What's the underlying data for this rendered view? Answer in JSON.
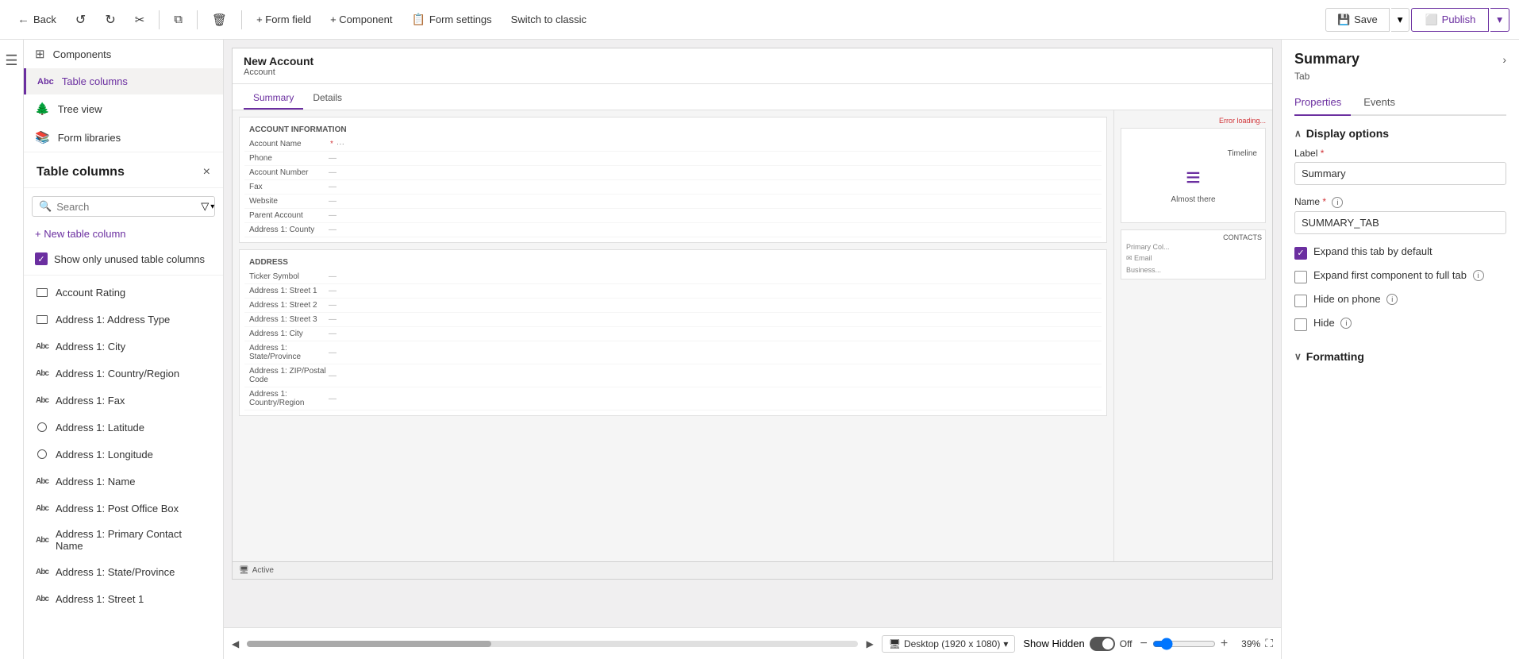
{
  "toolbar": {
    "back_label": "Back",
    "form_field_label": "+ Form field",
    "component_label": "+ Component",
    "form_settings_label": "Form settings",
    "switch_classic_label": "Switch to classic",
    "save_label": "Save",
    "publish_label": "Publish"
  },
  "left_panel": {
    "title": "Table columns",
    "close_label": "×",
    "search_placeholder": "Search",
    "new_column_label": "+ New table column",
    "show_unused_label": "Show only unused table columns",
    "nav_items": [
      {
        "id": "components",
        "label": "Components",
        "icon": "⊞"
      },
      {
        "id": "table-columns",
        "label": "Table columns",
        "icon": "Abc",
        "active": true
      },
      {
        "id": "tree-view",
        "label": "Tree view",
        "icon": "≡"
      },
      {
        "id": "form-libraries",
        "label": "Form libraries",
        "icon": "📚"
      }
    ],
    "columns": [
      {
        "id": "account-rating",
        "label": "Account Rating",
        "icon": "rect"
      },
      {
        "id": "address1-type",
        "label": "Address 1: Address Type",
        "icon": "rect"
      },
      {
        "id": "address1-city",
        "label": "Address 1: City",
        "icon": "abc"
      },
      {
        "id": "address1-country",
        "label": "Address 1: Country/Region",
        "icon": "abc"
      },
      {
        "id": "address1-fax",
        "label": "Address 1: Fax",
        "icon": "abc",
        "has_more": true
      },
      {
        "id": "address1-latitude",
        "label": "Address 1: Latitude",
        "icon": "circle"
      },
      {
        "id": "address1-longitude",
        "label": "Address 1: Longitude",
        "icon": "circle"
      },
      {
        "id": "address1-name",
        "label": "Address 1: Name",
        "icon": "abc"
      },
      {
        "id": "address1-po-box",
        "label": "Address 1: Post Office Box",
        "icon": "abc"
      },
      {
        "id": "address1-primary-contact",
        "label": "Address 1: Primary Contact Name",
        "icon": "abc"
      },
      {
        "id": "address1-state",
        "label": "Address 1: State/Province",
        "icon": "abc"
      },
      {
        "id": "address1-street1",
        "label": "Address 1: Street 1",
        "icon": "abc"
      }
    ]
  },
  "form_canvas": {
    "form_title": "New Account",
    "form_subtitle": "Account",
    "tabs": [
      {
        "label": "Summary",
        "active": true
      },
      {
        "label": "Details",
        "active": false
      }
    ],
    "account_info_section": "ACCOUNT INFORMATION",
    "fields": [
      {
        "label": "Account Name",
        "required": true,
        "value": "—"
      },
      {
        "label": "Phone",
        "value": "—"
      },
      {
        "label": "Account Number",
        "value": "—"
      },
      {
        "label": "Fax",
        "value": "—"
      },
      {
        "label": "Website",
        "value": "—"
      },
      {
        "label": "Parent Account",
        "value": "—"
      },
      {
        "label": "Address 1: County",
        "value": "—"
      }
    ],
    "timeline_label": "Timeline",
    "timeline_icon_text": "≡",
    "timeline_almost_there": "Almost there",
    "error_link": "Error loading...",
    "address_section": "ADDRESS",
    "address_fields": [
      {
        "label": "Ticker Symbol",
        "value": "—"
      },
      {
        "label": "Address 1: Street 1",
        "value": "—"
      },
      {
        "label": "Address 1: Street 2",
        "value": "—"
      },
      {
        "label": "Address 1: Street 3",
        "value": "—"
      },
      {
        "label": "Address 1: City",
        "value": "—"
      },
      {
        "label": "Address 1: State/Province",
        "value": "—"
      },
      {
        "label": "Address 1: ZIP/Postal Code",
        "value": "—"
      },
      {
        "label": "Address 1: Country/Region",
        "value": "—"
      }
    ],
    "status_label": "Active",
    "viewport_label": "Desktop (1920 x 1080)",
    "show_hidden_label": "Show Hidden",
    "toggle_state": "Off",
    "zoom_level": "39%"
  },
  "right_panel": {
    "title": "Summary",
    "subtitle": "Tab",
    "tabs": [
      {
        "label": "Properties",
        "active": true
      },
      {
        "label": "Events",
        "active": false
      }
    ],
    "display_options": {
      "section_label": "Display options",
      "label_field_label": "Label",
      "label_required": true,
      "label_value": "Summary",
      "name_field_label": "Name",
      "name_required": true,
      "name_value": "SUMMARY_TAB",
      "expand_tab_label": "Expand this tab by default",
      "expand_tab_checked": true,
      "expand_first_label": "Expand first component to full tab",
      "expand_first_checked": false,
      "hide_phone_label": "Hide on phone",
      "hide_phone_checked": false,
      "hide_info_icon": true,
      "hide_label": "Hide",
      "hide_checked": false,
      "hide_label_info": true
    },
    "formatting": {
      "section_label": "Formatting"
    }
  },
  "sidebar": {
    "menu_icon": "☰"
  }
}
